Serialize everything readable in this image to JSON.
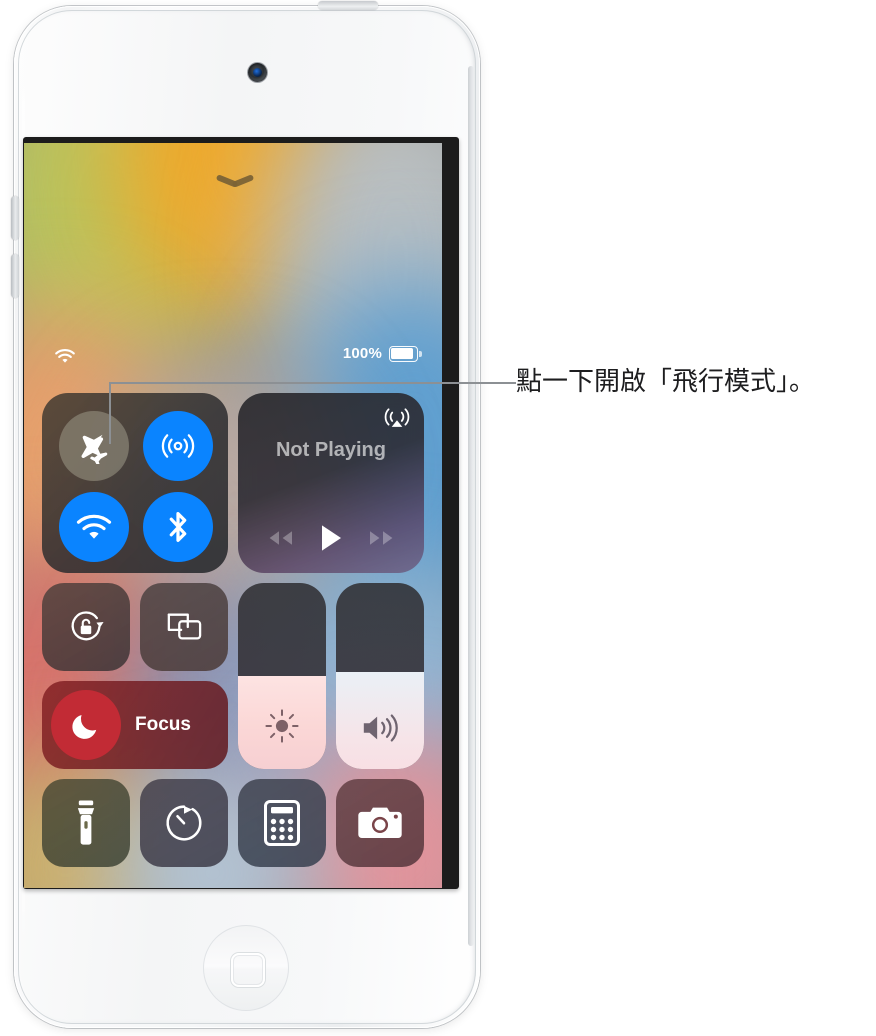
{
  "device": {
    "name": "ipod-touch",
    "body_color": "#f6f7f8",
    "parts": {
      "camera": "front-camera",
      "home_button": "home-button",
      "power_button": "power-button",
      "volume_up": "volume-up-button",
      "volume_down": "volume-down-button"
    }
  },
  "screen": {
    "wallpaper": "abstract blurred gradient",
    "grabber": "drag-handle-chevron"
  },
  "status_bar": {
    "wifi_icon": "wifi-icon",
    "battery_percent": "100%",
    "battery_icon": "battery-full-icon",
    "battery_level": 100
  },
  "control_center": {
    "connectivity": {
      "label": "connectivity-module",
      "buttons": [
        {
          "name": "airplane-mode",
          "icon": "airplane-icon",
          "state": "off",
          "color": "#948f80"
        },
        {
          "name": "airdrop",
          "icon": "airdrop-icon",
          "state": "on",
          "color": "#0a84ff"
        },
        {
          "name": "wifi",
          "icon": "wifi-icon",
          "state": "on",
          "color": "#0a84ff"
        },
        {
          "name": "bluetooth",
          "icon": "bluetooth-icon",
          "state": "on",
          "color": "#0a84ff"
        }
      ]
    },
    "media": {
      "title": "Not Playing",
      "airplay_icon": "airplay-audio-icon",
      "controls": [
        {
          "name": "rewind-button",
          "icon": "rewind-icon"
        },
        {
          "name": "play-button",
          "icon": "play-icon"
        },
        {
          "name": "fast-forward-button",
          "icon": "fast-forward-icon"
        }
      ]
    },
    "tiles": [
      {
        "name": "rotation-lock",
        "icon": "rotation-lock-icon",
        "state": "unlocked"
      },
      {
        "name": "screen-mirroring",
        "icon": "screen-mirroring-icon"
      }
    ],
    "focus": {
      "label": "Focus",
      "icon": "moon-icon",
      "color": "#c22b35"
    },
    "sliders": [
      {
        "name": "brightness-slider",
        "icon": "brightness-icon",
        "value": 50
      },
      {
        "name": "volume-slider",
        "icon": "volume-icon",
        "value": 52
      }
    ],
    "shortcuts": [
      {
        "name": "flashlight",
        "icon": "flashlight-icon"
      },
      {
        "name": "timer",
        "icon": "timer-icon"
      },
      {
        "name": "calculator",
        "icon": "calculator-icon"
      },
      {
        "name": "camera",
        "icon": "camera-icon"
      }
    ]
  },
  "callout": {
    "text": "點一下開啟「飛行模式」。",
    "line_color": "#8c9094",
    "points_to": "airplane-mode"
  }
}
